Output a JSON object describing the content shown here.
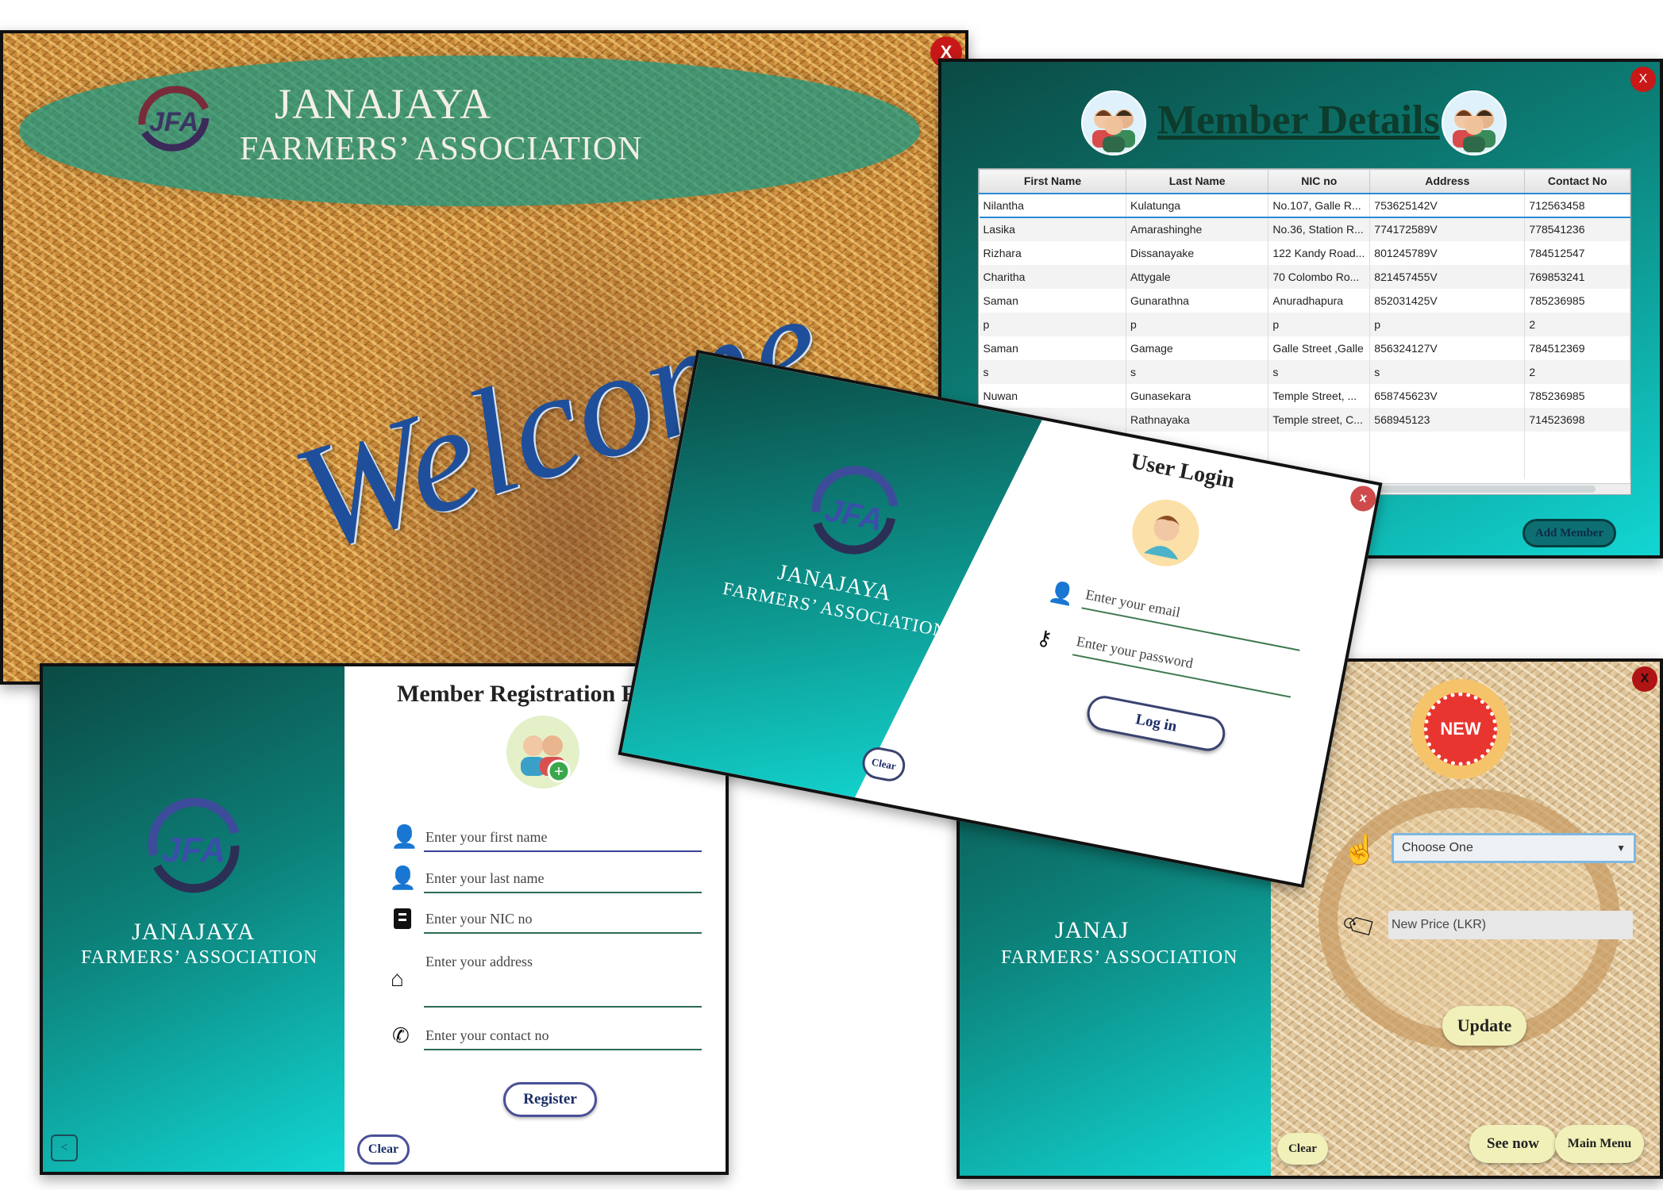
{
  "welcome_window": {
    "brand_line1": "JANAJAYA",
    "brand_line2": "FARMERS’ ASSOCIATION",
    "logo_text": "JFA",
    "welcome_text": "Welcome",
    "close_label": "X"
  },
  "member_details": {
    "title": "Member Details",
    "close_label": "X",
    "columns": [
      "First Name",
      "Last Name",
      "NIC no",
      "Address",
      "Contact No"
    ],
    "rows": [
      [
        "Nilantha",
        "Kulatunga",
        "No.107, Galle R...",
        "753625142V",
        "712563458"
      ],
      [
        "Lasika",
        "Amarashinghe",
        "No.36, Station R...",
        "774172589V",
        "778541236"
      ],
      [
        "Rizhara",
        "Dissanayake",
        "122 Kandy Road...",
        "801245789V",
        "784512547"
      ],
      [
        "Charitha",
        "Attygale",
        "70 Colombo Ro...",
        "821457455V",
        "769853241"
      ],
      [
        "Saman",
        "Gunarathna",
        "Anuradhapura",
        "852031425V",
        "785236985"
      ],
      [
        "p",
        "p",
        "p",
        "p",
        "2"
      ],
      [
        "Saman",
        "Gamage",
        "Galle Street ,Galle",
        "856324127V",
        "784512369"
      ],
      [
        "s",
        "s",
        "s",
        "s",
        "2"
      ],
      [
        "Nuwan",
        "Gunasekara",
        "Temple Street, ...",
        "658745623V",
        "785236985"
      ],
      [
        "",
        "Rathnayaka",
        "Temple street, C...",
        "568945123",
        "714523698"
      ]
    ],
    "add_button": "Add Member"
  },
  "registration": {
    "title": "Member Registration Fo",
    "brand_line1": "JANAJAYA",
    "brand_line2": "FARMERS’ ASSOCIATION",
    "logo_text": "JFA",
    "first_name_placeholder": "Enter your first name",
    "last_name_placeholder": "Enter your last name",
    "nic_placeholder": "Enter your NIC no",
    "address_placeholder": "Enter your address",
    "contact_placeholder": "Enter your contact no",
    "register_button": "Register",
    "clear_button": "Clear",
    "back_button": "<"
  },
  "login": {
    "title": "User Login",
    "brand_line1": "JANAJAYA",
    "brand_line2": "FARMERS’ ASSOCIATION",
    "logo_text": "JFA",
    "email_placeholder": "Enter your email",
    "password_placeholder": "Enter your password",
    "login_button": "Log in",
    "clear_button": "Clear",
    "close_label": "x"
  },
  "price_update": {
    "badge_text": "NEW",
    "brand_line1": "JANAJ",
    "brand_line2": "FARMERS’ ASSOCIATION",
    "select_value": "Choose One",
    "price_placeholder": "New Price (LKR)",
    "update_button": "Update",
    "see_now_button": "See now",
    "main_menu_button": "Main Menu",
    "clear_button": "Clear",
    "close_label": "X"
  },
  "colors": {
    "teal_dark": "#0b4a44",
    "teal_light": "#12d6d3",
    "close_red": "#c81818",
    "logo_blue": "#2f3f8f"
  }
}
